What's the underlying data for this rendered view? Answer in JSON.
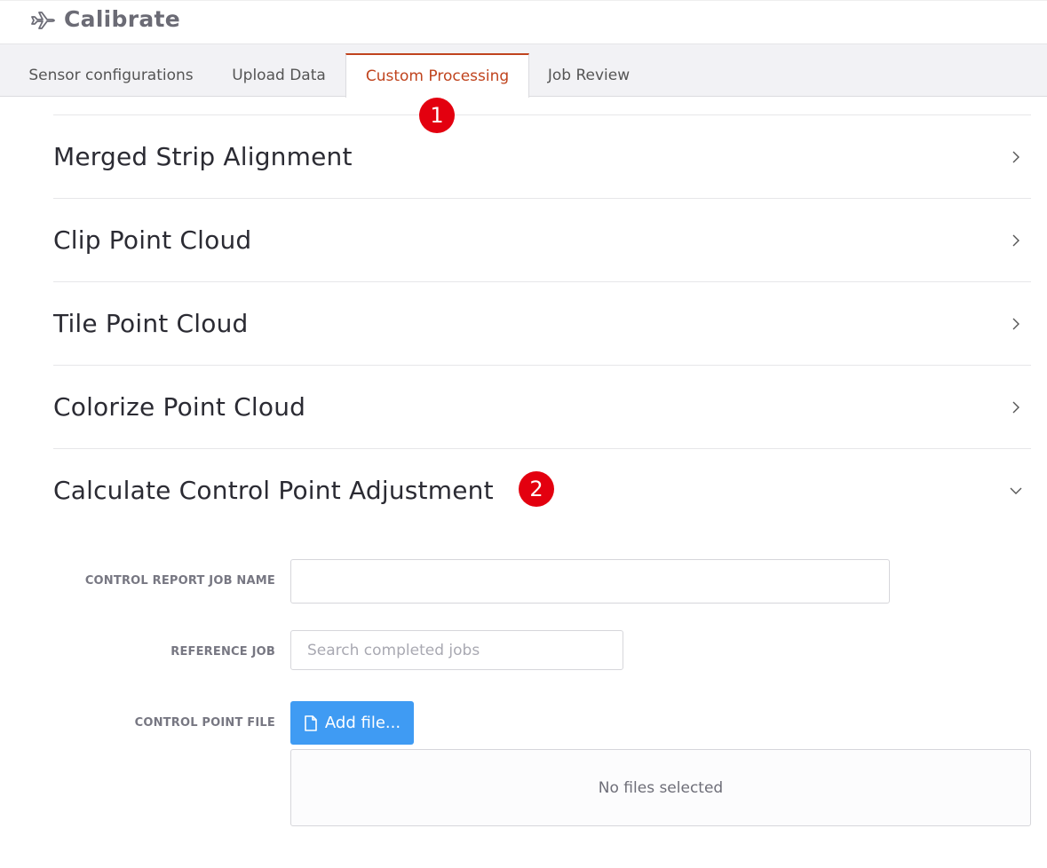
{
  "app": {
    "title": "Calibrate",
    "logo_icon": "airplane-icon"
  },
  "tabs": [
    {
      "label": "Sensor configurations",
      "active": false
    },
    {
      "label": "Upload Data",
      "active": false
    },
    {
      "label": "Custom Processing",
      "active": true
    },
    {
      "label": "Job Review",
      "active": false
    }
  ],
  "annotations": {
    "step1": "1",
    "step2": "2",
    "color": "#e3000f"
  },
  "panels": [
    {
      "title": "Merged Strip Alignment",
      "expanded": false,
      "icon": "chevron-right-icon"
    },
    {
      "title": "Clip Point Cloud",
      "expanded": false,
      "icon": "chevron-right-icon"
    },
    {
      "title": "Tile Point Cloud",
      "expanded": false,
      "icon": "chevron-right-icon"
    },
    {
      "title": "Colorize Point Cloud",
      "expanded": false,
      "icon": "chevron-right-icon"
    },
    {
      "title": "Calculate Control Point Adjustment",
      "expanded": true,
      "icon": "chevron-down-icon"
    }
  ],
  "form": {
    "job_name": {
      "label": "CONTROL REPORT JOB NAME",
      "value": "",
      "placeholder": ""
    },
    "reference_job": {
      "label": "REFERENCE JOB",
      "value": "",
      "placeholder": "Search completed jobs"
    },
    "control_point_file": {
      "label": "CONTROL POINT FILE",
      "button_label": "Add file...",
      "button_icon": "file-icon",
      "empty_text": "No files selected"
    }
  },
  "colors": {
    "accent": "#c0441e",
    "button": "#3f9bf3"
  }
}
